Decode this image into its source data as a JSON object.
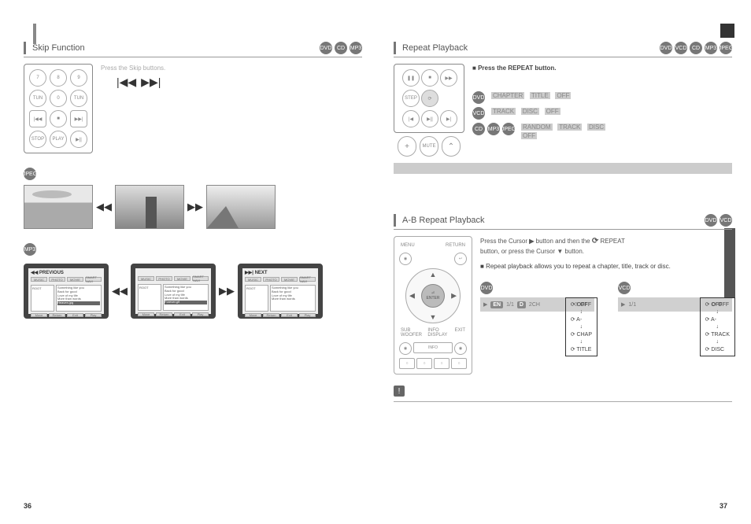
{
  "page_numbers": {
    "left": "36",
    "right": "37"
  },
  "left": {
    "section1": {
      "title": "Skip Function",
      "badges": [
        "DVD",
        "CD",
        "MP3"
      ],
      "instruction": "Press the Skip buttons.",
      "skip_icons": [
        "|◀◀",
        "▶▶|"
      ],
      "note_badge": "JPEG",
      "screen_labels": {
        "prev": "◀◀ PREVIOUS",
        "next": "▶▶| NEXT"
      },
      "menu_tabs": [
        "MUSIC",
        "PHOTO",
        "MOVIE",
        "SMART NAVI"
      ],
      "folder_label": "ROOT",
      "file_list": [
        "Something like you",
        "Back for good",
        "Love of my life",
        "More than words",
        "Heaven.jpg",
        "Forever.gif"
      ],
      "footer_btns": [
        "Move",
        "Return",
        "Exit",
        "Play"
      ]
    }
  },
  "right": {
    "section1": {
      "title": "Repeat Playback",
      "badges": [
        "DVD",
        "VCD",
        "CD",
        "MP3",
        "JPEG"
      ],
      "bullet": "Press the REPEAT button.",
      "remote_labels": [
        "PAUSE",
        "STOP",
        "FAST",
        "STEP",
        "REPEAT"
      ],
      "row1_badge": "DVD",
      "row1_text_parts": [
        "CHAPTER",
        "TITLE",
        "OFF"
      ],
      "row2_badge": "VCD",
      "row2_text_parts": [
        "TRACK",
        "DISC",
        "OFF"
      ],
      "row3_badges": [
        "CD",
        "MP3",
        "JPEG"
      ],
      "row3_text_parts": [
        "RANDOM",
        "TRACK",
        "DISC",
        "OFF"
      ],
      "gray_bar_text": " "
    },
    "section2": {
      "title": "A-B Repeat Playback",
      "badges": [
        "DVD",
        "VCD"
      ],
      "step1_parts": [
        "Press the Cursor",
        "▶",
        "button and then the",
        "⟳",
        "REPEAT"
      ],
      "step1_cont": "button, or press the Cursor ▼ button.",
      "bullet": "Repeat playback allows you to repeat a chapter, title, track or disc.",
      "badge_a": "DVD",
      "badge_b": "VCD",
      "info_bar": {
        "left_tags": [
          "EN",
          "1/1",
          "D",
          "2CH"
        ],
        "off": "OFF",
        "off_b": "OFF"
      },
      "flow_a": [
        "⟳ OFF",
        "↓",
        "⟳ A-",
        "↓",
        "⟳ CHAP",
        "↓",
        "⟳ TITLE"
      ],
      "flow_b": [
        "⟳ OFF",
        "↓",
        "⟳ A-",
        "↓",
        "⟳ TRACK",
        "↓",
        "⟳ DISC"
      ]
    },
    "notice": "!"
  }
}
